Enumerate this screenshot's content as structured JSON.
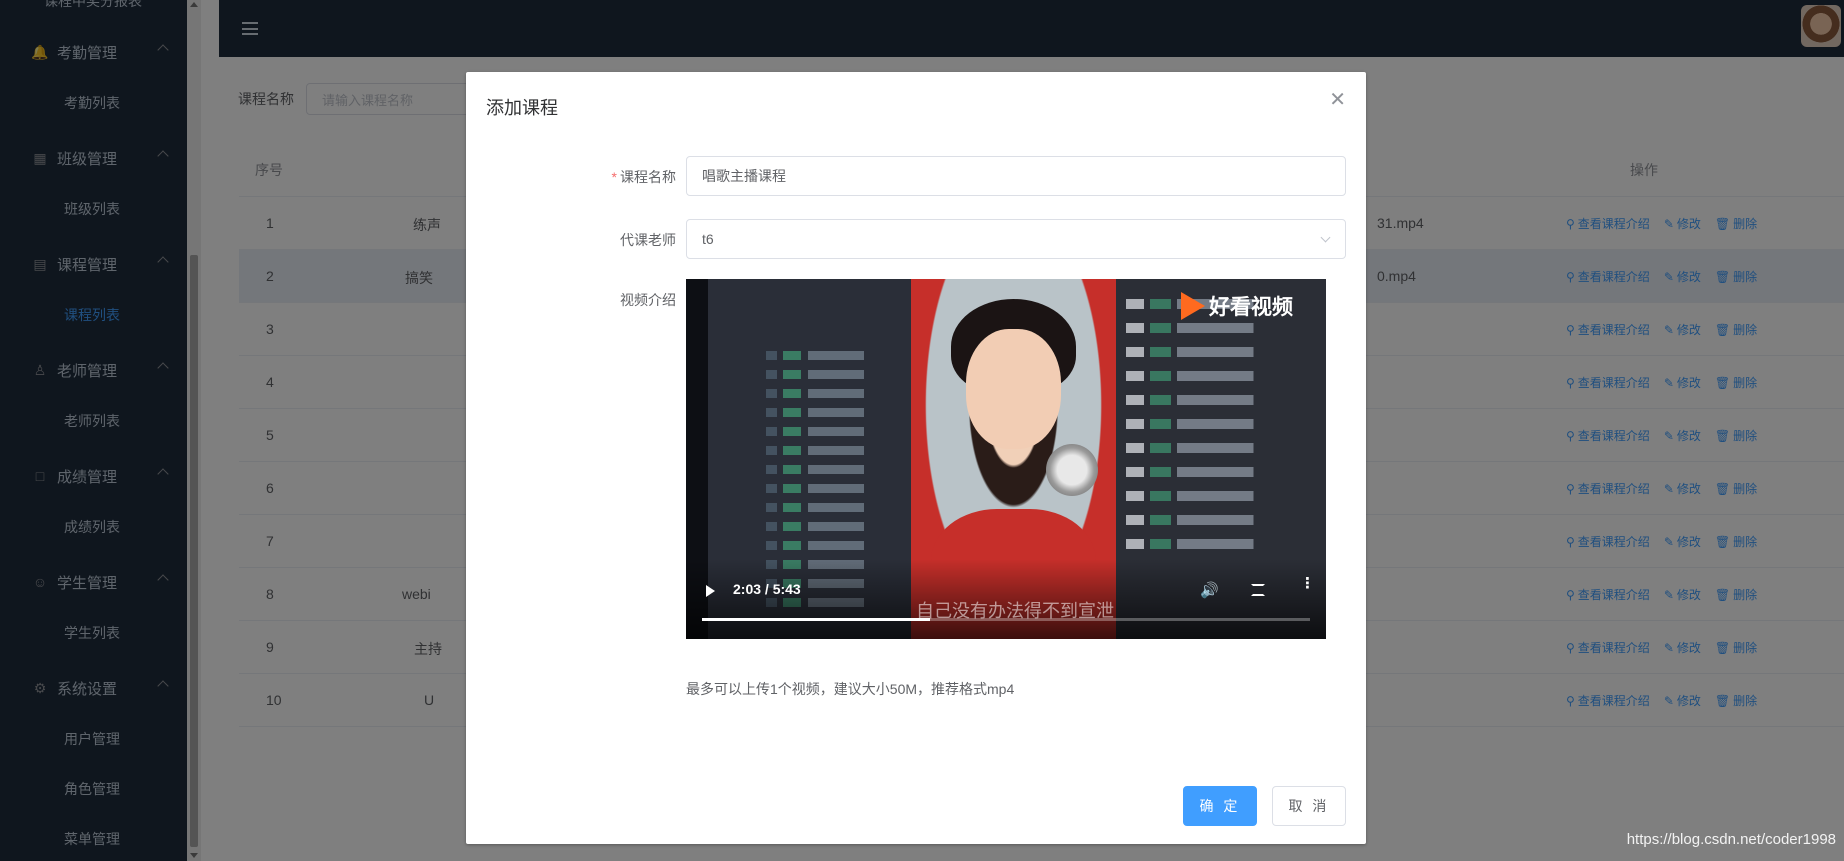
{
  "sidebar": {
    "cut_item": "课程中奖分报表",
    "groups": [
      {
        "label": "考勤管理",
        "icon": "bell-icon",
        "items": [
          "考勤列表"
        ]
      },
      {
        "label": "班级管理",
        "icon": "grid-icon",
        "items": [
          "班级列表"
        ]
      },
      {
        "label": "课程管理",
        "icon": "calendar-icon",
        "items": [
          "课程列表"
        ]
      },
      {
        "label": "老师管理",
        "icon": "user-icon",
        "items": [
          "老师列表"
        ]
      },
      {
        "label": "成绩管理",
        "icon": "document-icon",
        "items": [
          "成绩列表"
        ]
      },
      {
        "label": "学生管理",
        "icon": "user-outline-icon",
        "items": [
          "学生列表"
        ]
      },
      {
        "label": "系统设置",
        "icon": "gear-icon",
        "items": [
          "用户管理",
          "角色管理",
          "菜单管理"
        ]
      }
    ],
    "active_item": "课程列表"
  },
  "search": {
    "label": "课程名称",
    "placeholder": "请输入课程名称"
  },
  "table": {
    "headers": {
      "index": "序号",
      "ops": "操作"
    },
    "rows": [
      {
        "index": "1",
        "name": "练声",
        "file": "31.mp4"
      },
      {
        "index": "2",
        "name": "搞笑",
        "file": "0.mp4"
      },
      {
        "index": "3",
        "name": "",
        "file": ""
      },
      {
        "index": "4",
        "name": "",
        "file": ""
      },
      {
        "index": "5",
        "name": "",
        "file": ""
      },
      {
        "index": "6",
        "name": "",
        "file": ""
      },
      {
        "index": "7",
        "name": "",
        "file": ""
      },
      {
        "index": "8",
        "name": "webi",
        "file": ""
      },
      {
        "index": "9",
        "name": "主持",
        "file": ""
      },
      {
        "index": "10",
        "name": "U",
        "file": ""
      }
    ],
    "ops": {
      "view": "查看课程介绍",
      "edit": "修改",
      "delete": "删除"
    }
  },
  "dialog": {
    "title": "添加课程",
    "fields": {
      "course_name_label": "课程名称",
      "course_name_value": "唱歌主播课程",
      "teacher_label": "代课老师",
      "teacher_value": "t6",
      "video_label": "视频介绍"
    },
    "video": {
      "logo_text": "好看视频",
      "subtitle": "自己没有办法得不到宣泄",
      "time": "2:03 / 5:43",
      "progress": 0.375
    },
    "tip": "最多可以上传1个视频，建议大小50M，推荐格式mp4",
    "confirm_label": "确 定",
    "cancel_label": "取 消"
  },
  "watermark": "https://blog.csdn.net/coder1998",
  "colors": {
    "sidebar_bg": "#1f2d3d",
    "accent": "#409eff",
    "required": "#f56c6c",
    "logo_orange": "#ff6a1f"
  }
}
